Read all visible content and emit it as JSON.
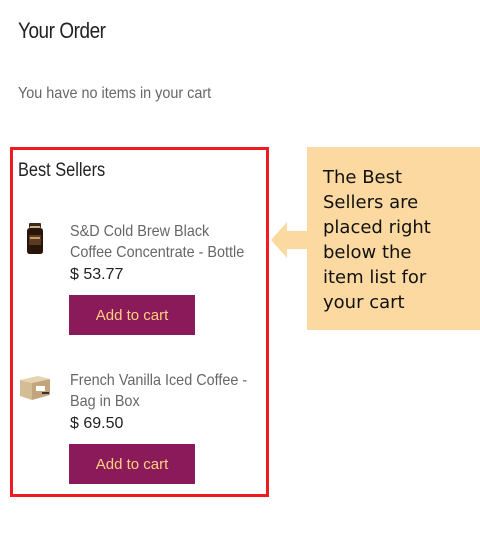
{
  "order": {
    "title": "Your Order",
    "empty_message": "You have no items in your cart"
  },
  "best_sellers": {
    "title": "Best Sellers",
    "products": [
      {
        "name_line1": "S&D Cold Brew Black",
        "name_line2": "Coffee Concentrate - Bottle",
        "price": "$ 53.77",
        "button": "Add to cart",
        "icon": "coffee-bottle-icon"
      },
      {
        "name_line1": "French Vanilla Iced Coffee -",
        "name_line2": "Bag in Box",
        "price": "$ 69.50",
        "button": "Add to cart",
        "icon": "bag-in-box-icon"
      }
    ]
  },
  "annotation": {
    "text": "The Best\nSellers are\nplaced right\nbelow the\nitem list for\nyour cart",
    "box_color": "#fbd9a0",
    "highlight_color": "#ee1c1c"
  },
  "colors": {
    "button_bg": "#8b1a5a",
    "button_text": "#ffd080"
  }
}
